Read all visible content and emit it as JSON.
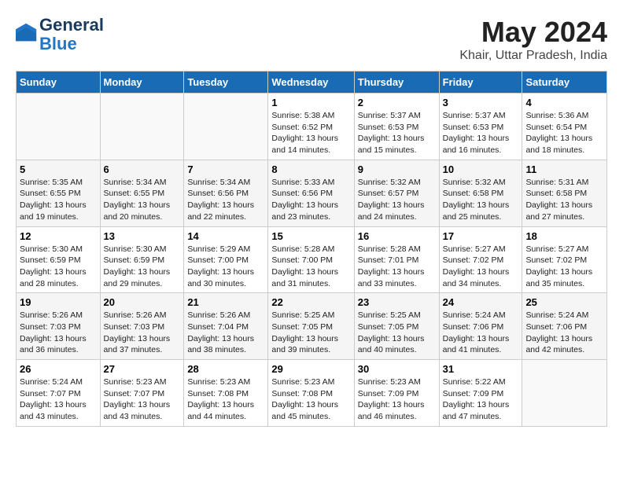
{
  "header": {
    "logo_line1": "General",
    "logo_line2": "Blue",
    "month_title": "May 2024",
    "location": "Khair, Uttar Pradesh, India"
  },
  "days_of_week": [
    "Sunday",
    "Monday",
    "Tuesday",
    "Wednesday",
    "Thursday",
    "Friday",
    "Saturday"
  ],
  "weeks": [
    [
      {
        "day": "",
        "sunrise": "",
        "sunset": "",
        "daylight": ""
      },
      {
        "day": "",
        "sunrise": "",
        "sunset": "",
        "daylight": ""
      },
      {
        "day": "",
        "sunrise": "",
        "sunset": "",
        "daylight": ""
      },
      {
        "day": "1",
        "sunrise": "Sunrise: 5:38 AM",
        "sunset": "Sunset: 6:52 PM",
        "daylight": "Daylight: 13 hours and 14 minutes."
      },
      {
        "day": "2",
        "sunrise": "Sunrise: 5:37 AM",
        "sunset": "Sunset: 6:53 PM",
        "daylight": "Daylight: 13 hours and 15 minutes."
      },
      {
        "day": "3",
        "sunrise": "Sunrise: 5:37 AM",
        "sunset": "Sunset: 6:53 PM",
        "daylight": "Daylight: 13 hours and 16 minutes."
      },
      {
        "day": "4",
        "sunrise": "Sunrise: 5:36 AM",
        "sunset": "Sunset: 6:54 PM",
        "daylight": "Daylight: 13 hours and 18 minutes."
      }
    ],
    [
      {
        "day": "5",
        "sunrise": "Sunrise: 5:35 AM",
        "sunset": "Sunset: 6:55 PM",
        "daylight": "Daylight: 13 hours and 19 minutes."
      },
      {
        "day": "6",
        "sunrise": "Sunrise: 5:34 AM",
        "sunset": "Sunset: 6:55 PM",
        "daylight": "Daylight: 13 hours and 20 minutes."
      },
      {
        "day": "7",
        "sunrise": "Sunrise: 5:34 AM",
        "sunset": "Sunset: 6:56 PM",
        "daylight": "Daylight: 13 hours and 22 minutes."
      },
      {
        "day": "8",
        "sunrise": "Sunrise: 5:33 AM",
        "sunset": "Sunset: 6:56 PM",
        "daylight": "Daylight: 13 hours and 23 minutes."
      },
      {
        "day": "9",
        "sunrise": "Sunrise: 5:32 AM",
        "sunset": "Sunset: 6:57 PM",
        "daylight": "Daylight: 13 hours and 24 minutes."
      },
      {
        "day": "10",
        "sunrise": "Sunrise: 5:32 AM",
        "sunset": "Sunset: 6:58 PM",
        "daylight": "Daylight: 13 hours and 25 minutes."
      },
      {
        "day": "11",
        "sunrise": "Sunrise: 5:31 AM",
        "sunset": "Sunset: 6:58 PM",
        "daylight": "Daylight: 13 hours and 27 minutes."
      }
    ],
    [
      {
        "day": "12",
        "sunrise": "Sunrise: 5:30 AM",
        "sunset": "Sunset: 6:59 PM",
        "daylight": "Daylight: 13 hours and 28 minutes."
      },
      {
        "day": "13",
        "sunrise": "Sunrise: 5:30 AM",
        "sunset": "Sunset: 6:59 PM",
        "daylight": "Daylight: 13 hours and 29 minutes."
      },
      {
        "day": "14",
        "sunrise": "Sunrise: 5:29 AM",
        "sunset": "Sunset: 7:00 PM",
        "daylight": "Daylight: 13 hours and 30 minutes."
      },
      {
        "day": "15",
        "sunrise": "Sunrise: 5:28 AM",
        "sunset": "Sunset: 7:00 PM",
        "daylight": "Daylight: 13 hours and 31 minutes."
      },
      {
        "day": "16",
        "sunrise": "Sunrise: 5:28 AM",
        "sunset": "Sunset: 7:01 PM",
        "daylight": "Daylight: 13 hours and 33 minutes."
      },
      {
        "day": "17",
        "sunrise": "Sunrise: 5:27 AM",
        "sunset": "Sunset: 7:02 PM",
        "daylight": "Daylight: 13 hours and 34 minutes."
      },
      {
        "day": "18",
        "sunrise": "Sunrise: 5:27 AM",
        "sunset": "Sunset: 7:02 PM",
        "daylight": "Daylight: 13 hours and 35 minutes."
      }
    ],
    [
      {
        "day": "19",
        "sunrise": "Sunrise: 5:26 AM",
        "sunset": "Sunset: 7:03 PM",
        "daylight": "Daylight: 13 hours and 36 minutes."
      },
      {
        "day": "20",
        "sunrise": "Sunrise: 5:26 AM",
        "sunset": "Sunset: 7:03 PM",
        "daylight": "Daylight: 13 hours and 37 minutes."
      },
      {
        "day": "21",
        "sunrise": "Sunrise: 5:26 AM",
        "sunset": "Sunset: 7:04 PM",
        "daylight": "Daylight: 13 hours and 38 minutes."
      },
      {
        "day": "22",
        "sunrise": "Sunrise: 5:25 AM",
        "sunset": "Sunset: 7:05 PM",
        "daylight": "Daylight: 13 hours and 39 minutes."
      },
      {
        "day": "23",
        "sunrise": "Sunrise: 5:25 AM",
        "sunset": "Sunset: 7:05 PM",
        "daylight": "Daylight: 13 hours and 40 minutes."
      },
      {
        "day": "24",
        "sunrise": "Sunrise: 5:24 AM",
        "sunset": "Sunset: 7:06 PM",
        "daylight": "Daylight: 13 hours and 41 minutes."
      },
      {
        "day": "25",
        "sunrise": "Sunrise: 5:24 AM",
        "sunset": "Sunset: 7:06 PM",
        "daylight": "Daylight: 13 hours and 42 minutes."
      }
    ],
    [
      {
        "day": "26",
        "sunrise": "Sunrise: 5:24 AM",
        "sunset": "Sunset: 7:07 PM",
        "daylight": "Daylight: 13 hours and 43 minutes."
      },
      {
        "day": "27",
        "sunrise": "Sunrise: 5:23 AM",
        "sunset": "Sunset: 7:07 PM",
        "daylight": "Daylight: 13 hours and 43 minutes."
      },
      {
        "day": "28",
        "sunrise": "Sunrise: 5:23 AM",
        "sunset": "Sunset: 7:08 PM",
        "daylight": "Daylight: 13 hours and 44 minutes."
      },
      {
        "day": "29",
        "sunrise": "Sunrise: 5:23 AM",
        "sunset": "Sunset: 7:08 PM",
        "daylight": "Daylight: 13 hours and 45 minutes."
      },
      {
        "day": "30",
        "sunrise": "Sunrise: 5:23 AM",
        "sunset": "Sunset: 7:09 PM",
        "daylight": "Daylight: 13 hours and 46 minutes."
      },
      {
        "day": "31",
        "sunrise": "Sunrise: 5:22 AM",
        "sunset": "Sunset: 7:09 PM",
        "daylight": "Daylight: 13 hours and 47 minutes."
      },
      {
        "day": "",
        "sunrise": "",
        "sunset": "",
        "daylight": ""
      }
    ]
  ]
}
